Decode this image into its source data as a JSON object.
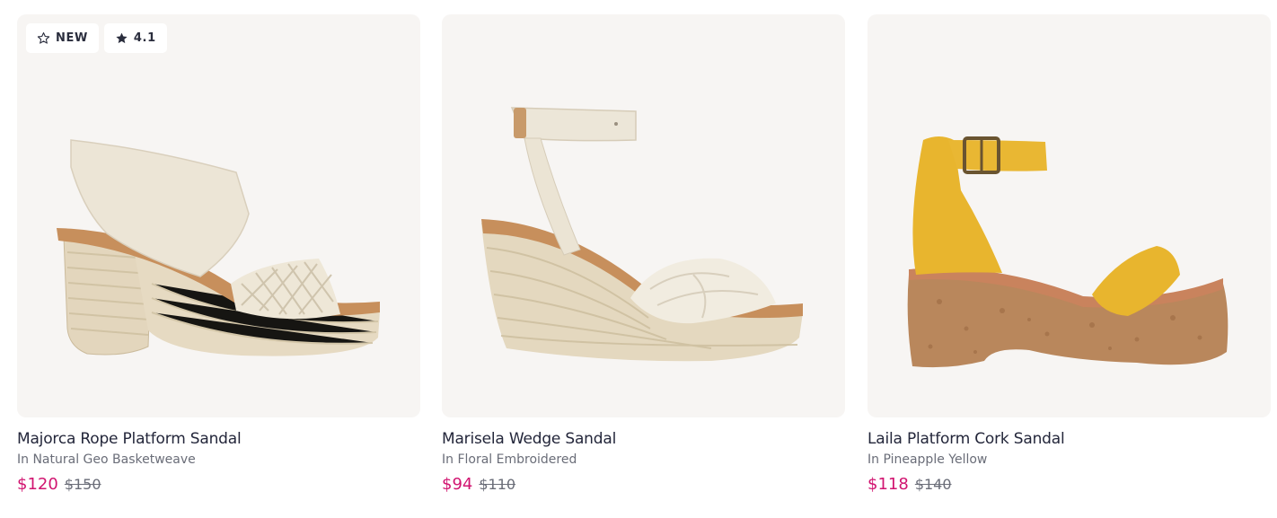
{
  "products": [
    {
      "name": "Majorca Rope Platform Sandal",
      "variant": "In Natural Geo Basketweave",
      "sale_price": "$120",
      "original_price": "$150",
      "badges": {
        "new_label": "NEW",
        "new_icon": "star-outline-icon",
        "rating": "4.1",
        "rating_icon": "star-filled-icon"
      }
    },
    {
      "name": "Marisela Wedge Sandal",
      "variant": "In Floral Embroidered",
      "sale_price": "$94",
      "original_price": "$110"
    },
    {
      "name": "Laila Platform Cork Sandal",
      "variant": "In Pineapple Yellow",
      "sale_price": "$118",
      "original_price": "$140"
    }
  ],
  "colors": {
    "sale_price": "#d11470",
    "card_background": "#f7f5f3",
    "title_text": "#23263a",
    "muted_text": "#6a6d78"
  }
}
